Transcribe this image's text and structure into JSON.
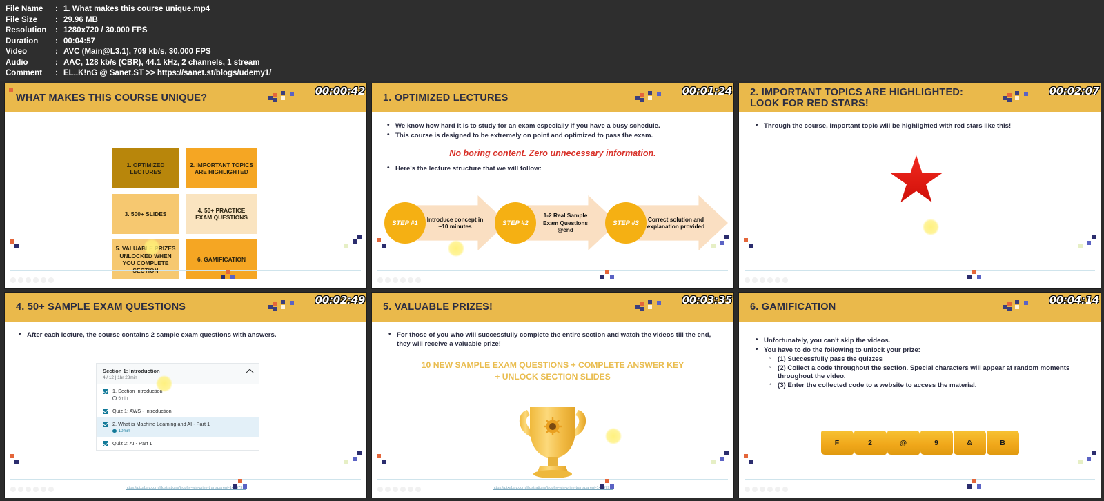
{
  "metadata": {
    "rows": [
      {
        "key": "File Name",
        "value": "1. What makes this course unique.mp4"
      },
      {
        "key": "File Size",
        "value": "29.96 MB"
      },
      {
        "key": "Resolution",
        "value": "1280x720 / 30.000 FPS"
      },
      {
        "key": "Duration",
        "value": "00:04:57"
      },
      {
        "key": "Video",
        "value": "AVC (Main@L3.1), 709 kb/s, 30.000 FPS"
      },
      {
        "key": "Audio",
        "value": "AAC, 128 kb/s (CBR), 44.1 kHz, 2 channels, 1 stream"
      },
      {
        "key": "Comment",
        "value": "EL..K!nG @ Sanet.ST  >> https://sanet.st/blogs/udemy1/"
      }
    ],
    "colon": ":"
  },
  "colors": {
    "header_bar": "#eab94b",
    "title_text": "#2b2d42",
    "accent_red": "#d8322a",
    "accent_yellow": "#e9bc4e",
    "checkbox_teal": "#137a99",
    "star_red": "#f22a20",
    "flag_gold": "#f0a71a"
  },
  "panels": [
    {
      "id": "panel-1",
      "timecode": "00:00:42",
      "title_line1": "WHAT MAKES THIS COURSE UNIQUE?",
      "title_line2": "",
      "boxes": [
        {
          "label": "1. OPTIMIZED LECTURES"
        },
        {
          "label": "2. IMPORTANT TOPICS ARE HIGHLIGHTED"
        },
        {
          "label": "3. 500+ SLIDES"
        },
        {
          "label": "4. 50+ PRACTICE EXAM QUESTIONS"
        },
        {
          "label": "5. VALUABLE PRIZES UNLOCKED WHEN YOU COMPLETE SECTION"
        },
        {
          "label": "6. GAMIFICATION"
        }
      ]
    },
    {
      "id": "panel-2",
      "timecode": "00:01:24",
      "title_line1": "1. OPTIMIZED LECTURES",
      "title_line2": "",
      "bullets": [
        "We know how hard it is to study for an exam especially if you have a busy schedule.",
        "This course is designed to be extremely on point and optimized to pass the exam."
      ],
      "emphasis": "No boring content. Zero unnecessary information.",
      "bullets2": [
        "Here's the lecture structure that we will follow:"
      ],
      "steps": [
        {
          "circle": "STEP #1",
          "text": "Introduce concept in ~10 minutes"
        },
        {
          "circle": "STEP #2",
          "text": "1-2 Real Sample Exam Questions @end"
        },
        {
          "circle": "STEP #3",
          "text": "Correct solution and explanation provided"
        }
      ]
    },
    {
      "id": "panel-3",
      "timecode": "00:02:07",
      "title_line1": "2. IMPORTANT TOPICS ARE HIGHLIGHTED:",
      "title_line2": "LOOK FOR RED STARS!",
      "bullets": [
        "Through the course, important topic will be highlighted with red stars like this!"
      ]
    },
    {
      "id": "panel-4",
      "timecode": "00:02:49",
      "title_line1": "4. 50+ SAMPLE EXAM QUESTIONS",
      "title_line2": "",
      "bullets": [
        "After each lecture, the course contains 2 sample exam questions with answers."
      ],
      "course_list": {
        "section_title": "Section 1: Introduction",
        "section_sub": "4 / 12  |  1hr 28min",
        "collapse_icon": "chevron-up-icon",
        "rows": [
          {
            "label": "1. Section Introduction",
            "duration": "6min",
            "selected": false,
            "duration_style": "grey"
          },
          {
            "label": "Quiz 1: AWS - Introduction",
            "duration": "",
            "selected": false,
            "duration_style": ""
          },
          {
            "label": "2. What is Machine Learning and AI - Part 1",
            "duration": "10min",
            "selected": true,
            "duration_style": "blue"
          },
          {
            "label": "Quiz 2: AI - Part 1",
            "duration": "",
            "selected": false,
            "duration_style": ""
          }
        ]
      },
      "credit": "https://pixabay.com/illustrations/trophy-win-prize-transparent-1414791/"
    },
    {
      "id": "panel-5",
      "timecode": "00:03:35",
      "title_line1": "5. VALUABLE PRIZES!",
      "title_line2": "",
      "bullets": [
        "For those of you who will successfully complete the entire section and watch the videos till the end, they will receive a valuable prize!"
      ],
      "headline_line1": "10 NEW SAMPLE EXAM QUESTIONS + COMPLETE ANSWER KEY",
      "headline_line2": "+ UNLOCK SECTION SLIDES",
      "image": "trophy-icon",
      "credit": "https://pixabay.com/illustrations/trophy-win-prize-transparent-1414791/"
    },
    {
      "id": "panel-6",
      "timecode": "00:04:14",
      "title_line1": "6. GAMIFICATION",
      "title_line2": "",
      "bullets": [
        "Unfortunately, you can't skip the videos.",
        "You have to do the following to unlock your prize:"
      ],
      "sub_bullets": [
        "(1) Successfully pass the quizzes",
        "(2) Collect a code throughout the section. Special characters will appear at random moments throughout the video.",
        "(3) Enter the collected code to a website to access the material."
      ],
      "code_flags": [
        "F",
        "2",
        "@",
        "9",
        "&",
        "B"
      ]
    }
  ]
}
